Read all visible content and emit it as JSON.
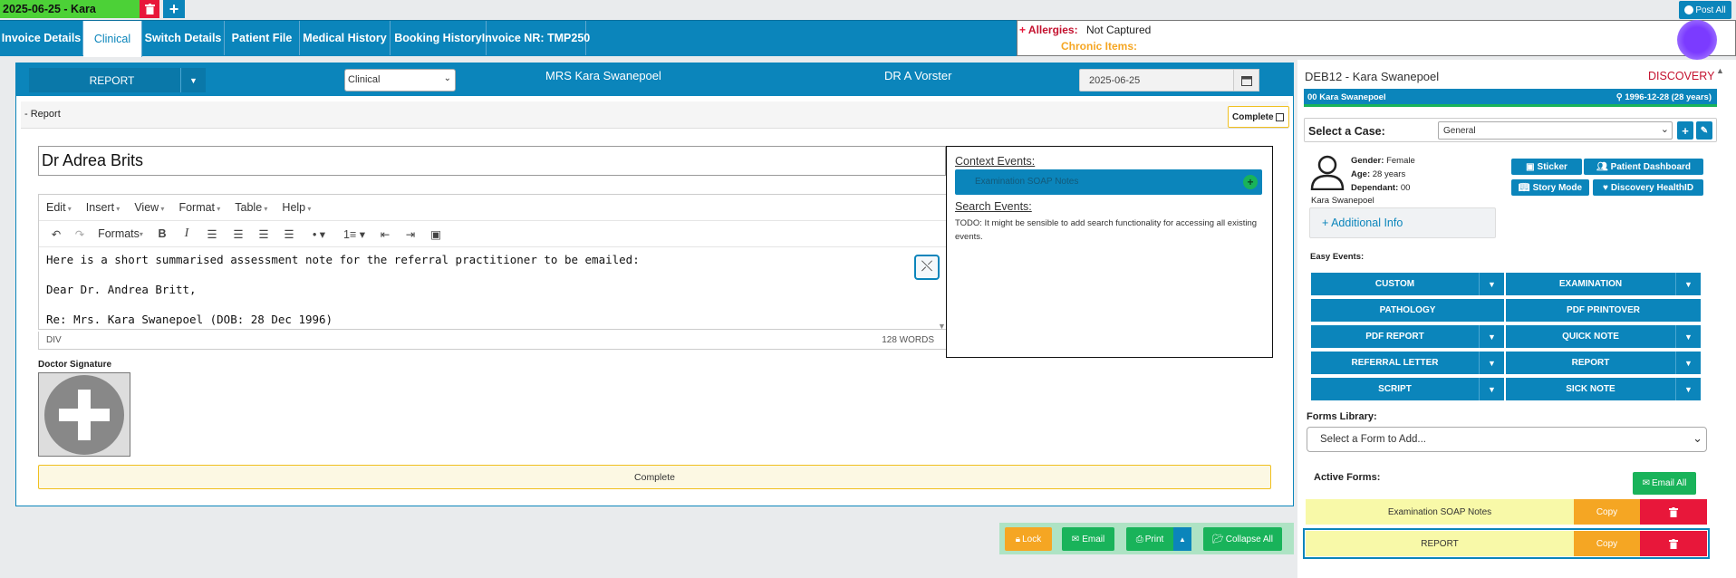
{
  "topbar": {
    "session_tab": "2025-06-25 - Kara",
    "post_all": "Post All"
  },
  "tabs": [
    "Invoice Details",
    "Clinical",
    "Switch Details",
    "Patient File",
    "Medical History",
    "Booking History",
    "Invoice NR: TMP250"
  ],
  "alerts": {
    "allergies_label": "Allergies:",
    "allergies_value": "Not Captured",
    "chronic_label": "Chronic Items:"
  },
  "report_header": {
    "report_btn": "REPORT",
    "select_value": "Clinical",
    "patient_name": "MRS Kara Swanepoel",
    "doctor": "DR A Vorster",
    "date": "2025-06-25"
  },
  "report_section": {
    "title": "Report",
    "complete_label": "Complete"
  },
  "editor": {
    "title_value": "Dr Adrea Brits",
    "menus": [
      "Edit",
      "Insert",
      "View",
      "Format",
      "Table",
      "Help"
    ],
    "formats_label": "Formats",
    "lines": [
      "Here is a short summarised assessment note for the referral practitioner to be emailed:",
      "Dear Dr. Andrea Britt,",
      "Re: Mrs. Kara Swanepoel (DOB: 28 Dec 1996)"
    ],
    "status_path": "DIV",
    "word_count": "128 WORDS"
  },
  "signature": {
    "label": "Doctor Signature"
  },
  "complete_bar": "Complete",
  "context": {
    "context_title": "Context Events:",
    "context_item": "Examination SOAP Notes",
    "search_title": "Search Events:",
    "search_text": "TODO: It might be sensible to add search functionality for accessing all existing events."
  },
  "bottom_buttons": {
    "lock": "Lock",
    "email": "Email",
    "print": "Print",
    "collapse": "Collapse All"
  },
  "sidebar": {
    "code_name": "DEB12 - Kara Swanepoel",
    "scheme": "DISCOVERY",
    "bar_left": "00 Kara Swanepoel",
    "bar_right": "1996-12-28 (28 years)",
    "case_label": "Select a Case:",
    "case_value": "General",
    "gender_label": "Gender:",
    "gender": "Female",
    "age_label": "Age:",
    "age": "28 years",
    "dependant_label": "Dependant:",
    "dependant": "00",
    "patient_name": "Kara Swanepoel",
    "buttons": {
      "sticker": "Sticker",
      "dashboard": "Patient Dashboard",
      "story": "Story Mode",
      "health": "Discovery HealthID"
    },
    "additional_info": "+ Additional Info",
    "easy_events_label": "Easy Events:",
    "events": [
      "CUSTOM",
      "EXAMINATION",
      "PATHOLOGY",
      "PDF PRINTOVER",
      "PDF REPORT",
      "QUICK NOTE",
      "REFERRAL LETTER",
      "REPORT",
      "SCRIPT",
      "SICK NOTE"
    ],
    "forms_library_label": "Forms Library:",
    "forms_select": "Select a Form to Add...",
    "active_forms_label": "Active Forms:",
    "email_all": "Email All",
    "active_forms": [
      {
        "name": "Examination SOAP Notes",
        "copy": "Copy"
      },
      {
        "name": "REPORT",
        "copy": "Copy"
      }
    ]
  },
  "colors": {
    "primary": "#0b85bb",
    "green": "#19b35a",
    "orange": "#f5a623",
    "red": "#e8173a",
    "yellow": "#f8f9a8",
    "purple": "#6b2ee8"
  }
}
